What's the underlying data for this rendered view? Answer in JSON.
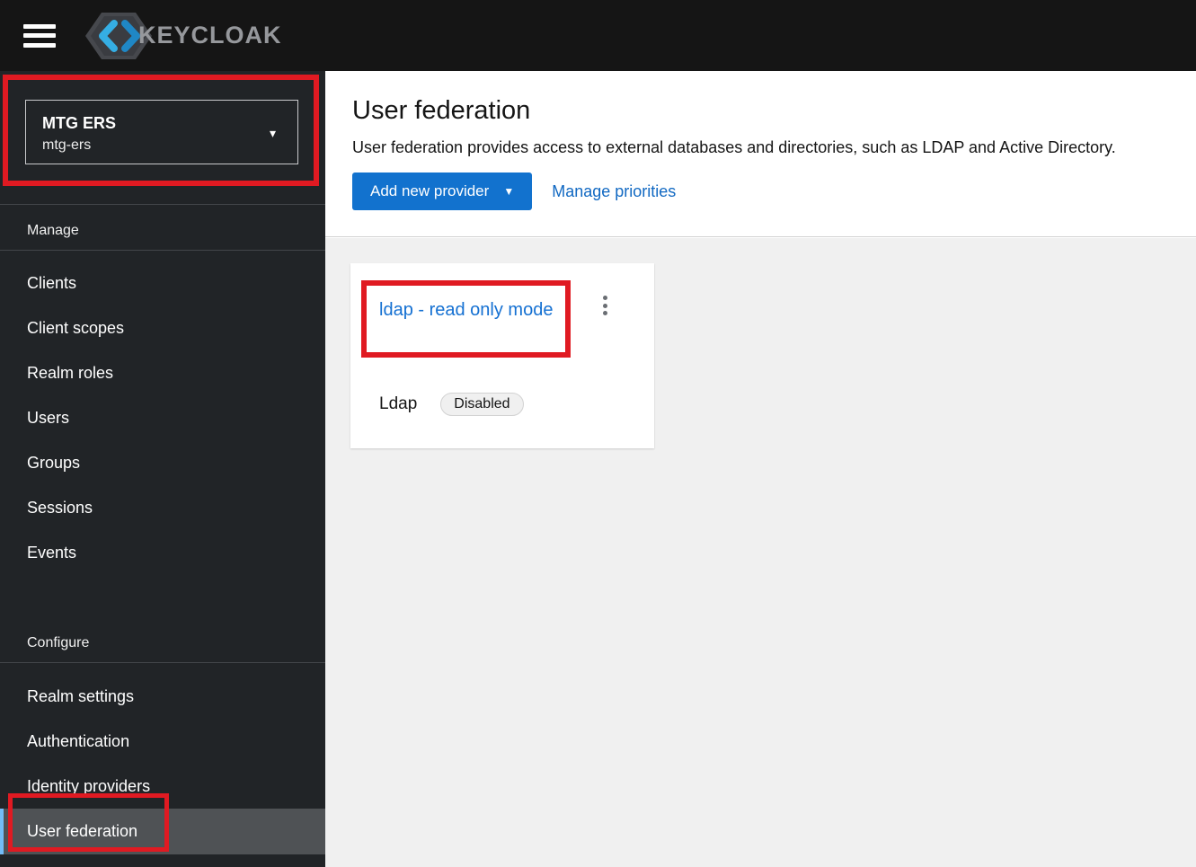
{
  "topbar": {
    "brand": "KEYCLOAK"
  },
  "sidebar": {
    "realm": {
      "name": "MTG ERS",
      "id": "mtg-ers"
    },
    "manage": {
      "header": "Manage",
      "items": [
        "Clients",
        "Client scopes",
        "Realm roles",
        "Users",
        "Groups",
        "Sessions",
        "Events"
      ]
    },
    "configure": {
      "header": "Configure",
      "items": [
        "Realm settings",
        "Authentication",
        "Identity providers",
        "User federation"
      ],
      "selected_item": "User federation"
    }
  },
  "main": {
    "title": "User federation",
    "description": "User federation provides access to external databases and directories, such as LDAP and Active Directory.",
    "add_provider_button": "Add new provider",
    "manage_priorities_link": "Manage priorities",
    "provider_card": {
      "title": "ldap - read only mode",
      "type": "Ldap",
      "status_badge": "Disabled"
    }
  },
  "icons": {
    "menu": "hamburger-icon",
    "realm_caret": "chevron-down-icon",
    "button_caret": "chevron-down-icon",
    "kebab": "kebab-menu-icon"
  },
  "colors": {
    "topbar_bg": "#151515",
    "sidebar_bg": "#212427",
    "selected_item_bg": "#4f5255",
    "selected_indicator_blue": "#73bcf7",
    "accent_blue": "#1272ce",
    "link_blue": "#1068c2",
    "annotation_red": "#e01a22",
    "content_bg": "#f0f0f0"
  }
}
